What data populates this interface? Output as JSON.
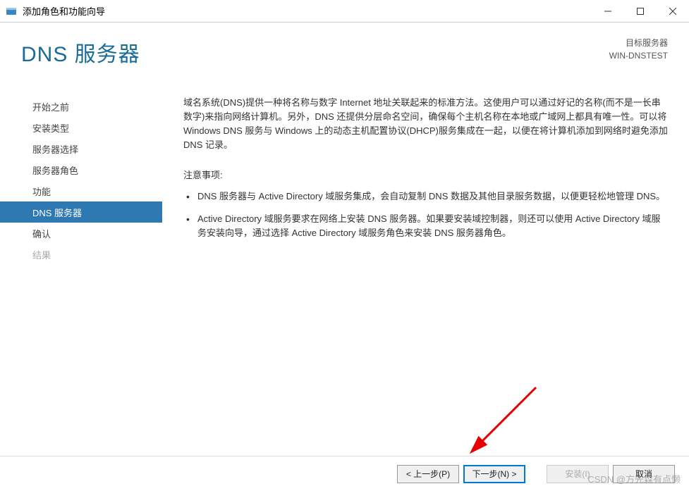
{
  "window": {
    "title": "添加角色和功能向导"
  },
  "header": {
    "page_title": "DNS 服务器",
    "target_label": "目标服务器",
    "target_server": "WIN-DNSTEST"
  },
  "sidebar": {
    "items": [
      {
        "label": "开始之前",
        "state": "normal"
      },
      {
        "label": "安装类型",
        "state": "normal"
      },
      {
        "label": "服务器选择",
        "state": "normal"
      },
      {
        "label": "服务器角色",
        "state": "normal"
      },
      {
        "label": "功能",
        "state": "normal"
      },
      {
        "label": "DNS 服务器",
        "state": "active"
      },
      {
        "label": "确认",
        "state": "normal"
      },
      {
        "label": "结果",
        "state": "disabled"
      }
    ]
  },
  "main": {
    "description": "域名系统(DNS)提供一种将名称与数字 Internet 地址关联起来的标准方法。这使用户可以通过好记的名称(而不是一长串数字)来指向网络计算机。另外，DNS 还提供分层命名空间，确保每个主机名称在本地或广域网上都具有唯一性。可以将 Windows DNS 服务与 Windows 上的动态主机配置协议(DHCP)服务集成在一起，以便在将计算机添加到网络时避免添加 DNS 记录。",
    "notes_label": "注意事项:",
    "notes": [
      "DNS 服务器与 Active Directory 域服务集成，会自动复制 DNS 数据及其他目录服务数据，以便更轻松地管理 DNS。",
      "Active Directory 域服务要求在网络上安装 DNS 服务器。如果要安装域控制器，则还可以使用 Active Directory 域服务安装向导，通过选择 Active Directory 域服务角色来安装 DNS 服务器角色。"
    ]
  },
  "footer": {
    "prev": "< 上一步(P)",
    "next": "下一步(N) >",
    "install": "安装(I)",
    "cancel": "取消"
  },
  "watermark": "CSDN @方先森有点懒"
}
